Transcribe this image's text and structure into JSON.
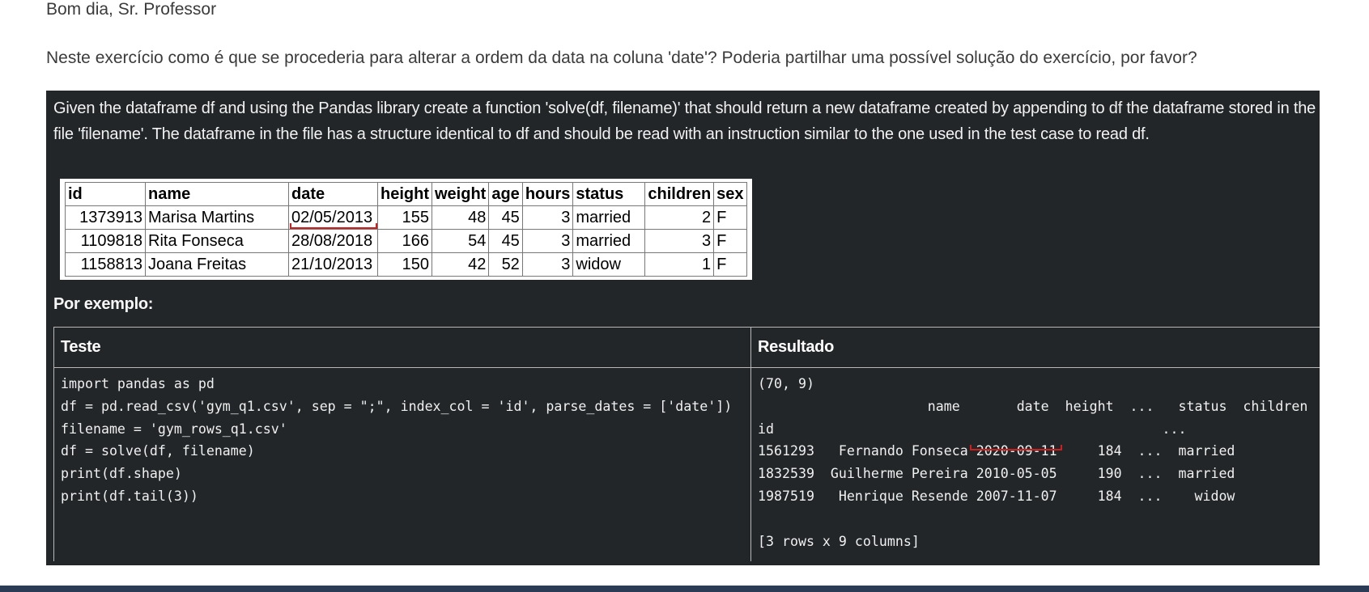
{
  "post": {
    "greeting": "Bom dia, Sr. Professor",
    "question": "Neste exercício como é que se procederia para alterar a ordem da data na coluna 'date'? Poderia partilhar uma possível solução do exercício, por favor?"
  },
  "exercise": {
    "description": "Given the dataframe df and using the Pandas library create a function 'solve(df, filename)' that should return a new dataframe created by appending to df the dataframe stored in the file 'filename'. The dataframe in the file has a structure identical to df and should be read with an instruction similar to the one used in the test case to read df.",
    "data_table": {
      "columns": [
        "id",
        "name",
        "date",
        "height",
        "weight",
        "age",
        "hours",
        "status",
        "children",
        "sex"
      ],
      "rows": [
        [
          "1373913",
          "Marisa Martins",
          "02/05/2013",
          "155",
          "48",
          "45",
          "3",
          "married",
          "2",
          "F"
        ],
        [
          "1109818",
          "Rita Fonseca",
          "28/08/2018",
          "166",
          "54",
          "45",
          "3",
          "married",
          "3",
          "F"
        ],
        [
          "1158813",
          "Joana Freitas",
          "21/10/2013",
          "150",
          "42",
          "52",
          "3",
          "widow",
          "1",
          "F"
        ]
      ]
    },
    "example_label": "Por exemplo:",
    "test_header": "Teste",
    "result_header": "Resultado",
    "test_code": "import pandas as pd\ndf = pd.read_csv('gym_q1.csv', sep = \";\", index_col = 'id', parse_dates = ['date'])\nfilename = 'gym_rows_q1.csv'\ndf = solve(df, filename)\nprint(df.shape)\nprint(df.tail(3))",
    "result_output": "(70, 9)\n                     name       date  height  ...   status  children\nid                                                ...                   \n1561293   Fernando Fonseca 2020-09-11     184  ...  married\n1832539  Guilherme Pereira 2010-05-05     190  ...  married\n1987519   Henrique Resende 2007-11-07     184  ...    widow\n\n[3 rows x 9 columns]"
  },
  "colors": {
    "panel_background": "#222629",
    "annotation_red": "#d01e1e",
    "footer_bar": "#2b3a55"
  }
}
